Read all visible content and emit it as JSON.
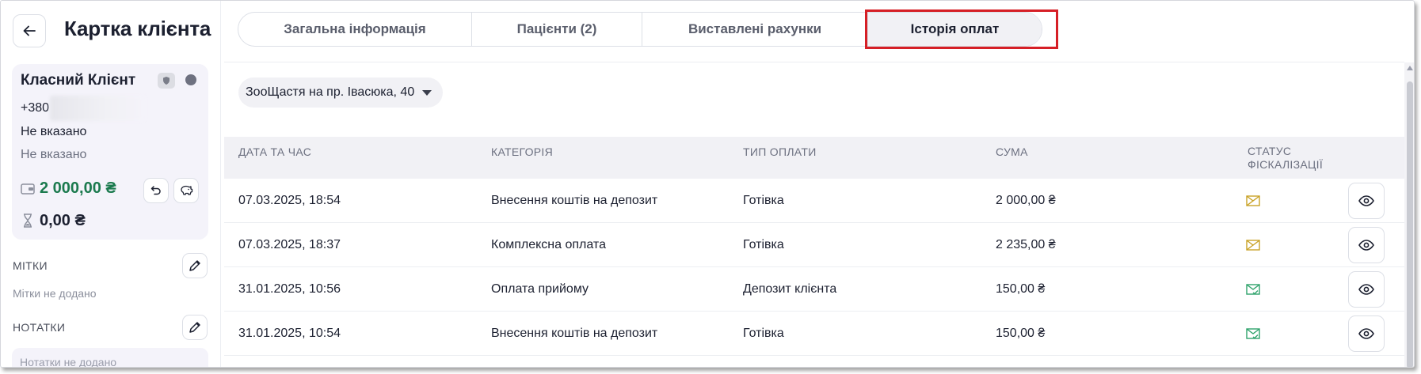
{
  "header": {
    "title": "Картка клієнта",
    "back_icon": "arrow-left-icon"
  },
  "client": {
    "name": "Класний Клієнт",
    "phone_prefix": "+380",
    "field1": "Не вказано",
    "field2": "Не вказано",
    "balance": "2 000,00 ₴",
    "debt": "0,00 ₴",
    "icons": {
      "badge": "shield-icon",
      "wallet": "wallet-icon",
      "refund": "undo-icon",
      "piggy": "piggy-bank-icon",
      "hourglass": "hourglass-icon"
    }
  },
  "tags": {
    "label": "МІТКИ",
    "empty": "Мітки не додано"
  },
  "notes": {
    "label": "НОТАТКИ",
    "empty": "Нотатки не додано"
  },
  "tabs": [
    {
      "label": "Загальна інформація",
      "active": false
    },
    {
      "label": "Пацієнти (2)",
      "active": false
    },
    {
      "label": "Виставлені рахунки",
      "active": false
    },
    {
      "label": "Історія оплат",
      "active": true
    }
  ],
  "filter": {
    "clinic": "ЗооЩастя на пр. Івасюка, 40"
  },
  "table": {
    "headers": {
      "datetime": "ДАТА ТА ЧАС",
      "category": "КАТЕГОРІЯ",
      "payment_type": "ТИП ОПЛАТИ",
      "amount": "СУМА",
      "fiscal_line1": "СТАТУС",
      "fiscal_line2": "ФІСКАЛІЗАЦІЇ"
    },
    "rows": [
      {
        "datetime": "07.03.2025, 18:54",
        "category": "Внесення коштів на депозит",
        "payment_type": "Готівка",
        "amount": "2 000,00 ₴",
        "fiscal_status": "not-fiscalized"
      },
      {
        "datetime": "07.03.2025, 18:37",
        "category": "Комплексна оплата",
        "payment_type": "Готівка",
        "amount": "2 235,00 ₴",
        "fiscal_status": "not-fiscalized"
      },
      {
        "datetime": "31.01.2025, 10:56",
        "category": "Оплата прийому",
        "payment_type": "Депозит клієнта",
        "amount": "150,00 ₴",
        "fiscal_status": "fiscalized"
      },
      {
        "datetime": "31.01.2025, 10:54",
        "category": "Внесення коштів на депозит",
        "payment_type": "Готівка",
        "amount": "150,00 ₴",
        "fiscal_status": "fiscalized"
      }
    ]
  },
  "colors": {
    "accent_green": "#1b7a4e",
    "fiscal_warn": "#c9a227",
    "fiscal_ok": "#2fa36b",
    "highlight": "#d61f26"
  }
}
